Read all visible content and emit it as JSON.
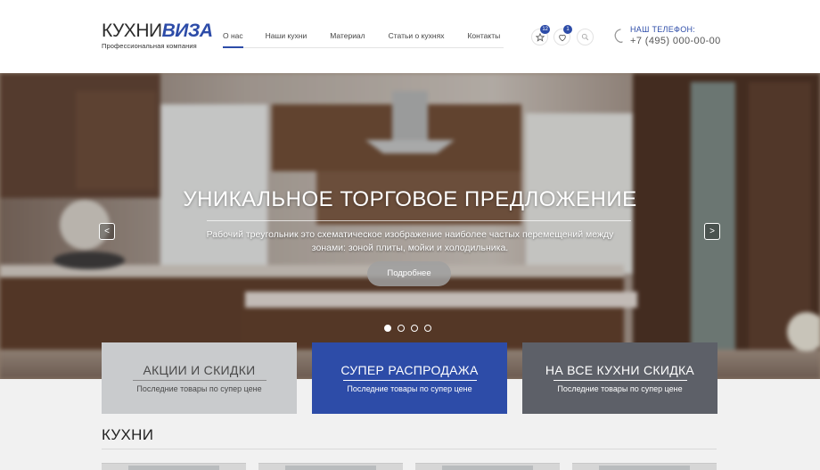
{
  "header": {
    "logo": {
      "part1": "КУХНИ",
      "part2": "ВИЗА",
      "tagline": "Профессиональная компания"
    },
    "nav": [
      {
        "label": "О нас",
        "active": true
      },
      {
        "label": "Наши кухни",
        "active": false
      },
      {
        "label": "Материал",
        "active": false
      },
      {
        "label": "Статьи о кухнях",
        "active": false
      },
      {
        "label": "Контакты",
        "active": false
      }
    ],
    "icons": [
      {
        "name": "star-icon",
        "badge": "12"
      },
      {
        "name": "heart-icon",
        "badge": "1"
      },
      {
        "name": "search-icon",
        "badge": ""
      }
    ],
    "phone": {
      "label": "НАШ ТЕЛЕФОН:",
      "number": "+7 (495) 000-00-00"
    }
  },
  "hero": {
    "title": "УНИКАЛЬНОЕ ТОРГОВОЕ ПРЕДЛОЖЕНИЕ",
    "description": "Рабочий треугольник это схематическое изображение наиболее частых перемещений между зонами: зоной плиты, мойки и холодильника.",
    "button": "Подробнее",
    "prev": "<",
    "next": ">",
    "slides": 4,
    "active_slide": 1
  },
  "promos": [
    {
      "title": "АКЦИИ И СКИДКИ",
      "subtitle": "Последние товары по супер цене",
      "bg": "#c9cbcd",
      "text": "#4a4a4a",
      "line": "#8a8a8a"
    },
    {
      "title": "СУПЕР РАСПРОДАЖА",
      "subtitle": "Последние товары по супер цене",
      "bg": "#2d4ca8",
      "text": "#ffffff",
      "line": "#ffffff"
    },
    {
      "title": "НА ВСЕ КУХНИ СКИДКА",
      "subtitle": "Последние товары по супер цене",
      "bg": "#5d6068",
      "text": "#ffffff",
      "line": "#ffffff"
    }
  ],
  "section": {
    "title": "КУХНИ"
  },
  "colors": {
    "accent": "#2d4ca8"
  }
}
